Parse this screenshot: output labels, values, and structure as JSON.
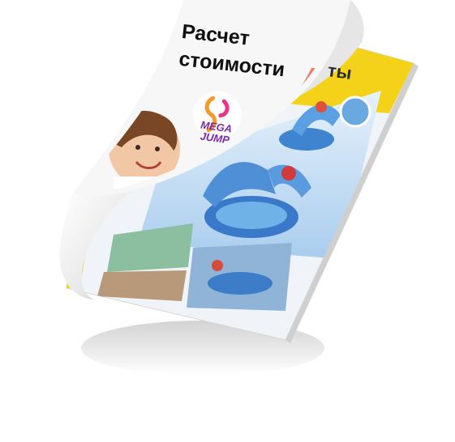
{
  "brochure": {
    "cover_title_line1": "Расчет",
    "cover_title_line2": "стоимости",
    "back_page_heading_fragment": "ты",
    "logo_text_line1": "MEGA",
    "logo_text_line2": "JUMP"
  },
  "colors": {
    "yellow_band": "#f5d21a",
    "page_white": "#f4f4f4",
    "gradient_orange": "#f7a23c",
    "gradient_pink": "#e8358a",
    "gradient_purple": "#7b3cc4",
    "sky_blue": "#7fb6e8",
    "pool_blue": "#4f8fd6"
  },
  "icons": [
    "logo-mark-icon"
  ]
}
